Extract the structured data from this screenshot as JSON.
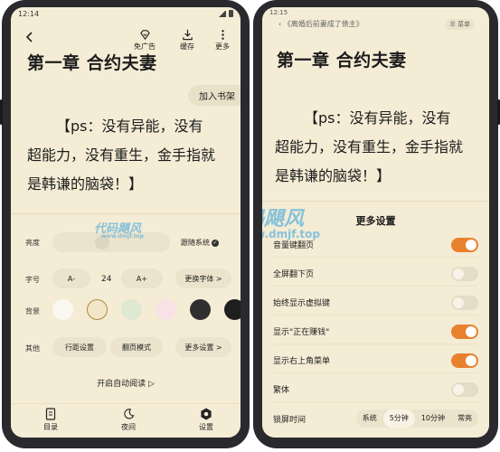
{
  "left": {
    "status": {
      "time": "12:14"
    },
    "toolbar": {
      "ad_free": "免广告",
      "cache": "缓存",
      "more": "更多"
    },
    "chapter_title": "第一章 合约夫妻",
    "add_shelf": "加入书架",
    "body_lines": [
      "【ps：没有异能，没有",
      "超能力，没有重生，金手指就",
      "是韩谦的脑袋！】"
    ],
    "panel": {
      "brightness_label": "亮度",
      "follow_system": "跟随系统",
      "font_label": "字号",
      "font_minus": "A-",
      "font_size": "24",
      "font_plus": "A+",
      "change_font": "更换字体 >",
      "bg_label": "背景",
      "other_label": "其他",
      "line_spacing": "行距设置",
      "page_mode": "翻页模式",
      "more_settings": "更多设置 >",
      "auto_read": "开启自动阅读 ▷"
    },
    "bottom_nav": {
      "toc": "目录",
      "night": "夜间",
      "settings": "设置"
    },
    "swatches": [
      "#fbf8f1",
      "#f1e7c8",
      "#dfe8d3",
      "#f8e2e6",
      "#2f2f2f",
      "#1e1e1e"
    ]
  },
  "right": {
    "status": {
      "time": "12:15"
    },
    "book_title": "《离婚后前妻成了债主》",
    "menu": "菜单",
    "chapter_title": "第一章 合约夫妻",
    "body_lines": [
      "【ps：没有异能，没有",
      "超能力，没有重生，金手指就",
      "是韩谦的脑袋！】"
    ],
    "sheet": {
      "title": "更多设置",
      "rows": [
        {
          "label": "音量键翻页",
          "on": true
        },
        {
          "label": "全屏翻下页",
          "on": false
        },
        {
          "label": "始终显示虚拟键",
          "on": false
        },
        {
          "label": "显示\"正在赚钱\"",
          "on": true
        },
        {
          "label": "显示右上角菜单",
          "on": true
        },
        {
          "label": "繁体",
          "on": false
        }
      ],
      "lock_label": "锁屏时间",
      "lock_options": [
        "系统",
        "5分钟",
        "10分钟",
        "常亮"
      ],
      "lock_selected": "5分钟"
    }
  },
  "watermark": {
    "brand": "代码飓风",
    "site": "www.dmjf.top"
  },
  "colors": {
    "accent": "#e8812e",
    "paper": "#f4ecd5",
    "bezel": "#2a2a2e"
  }
}
